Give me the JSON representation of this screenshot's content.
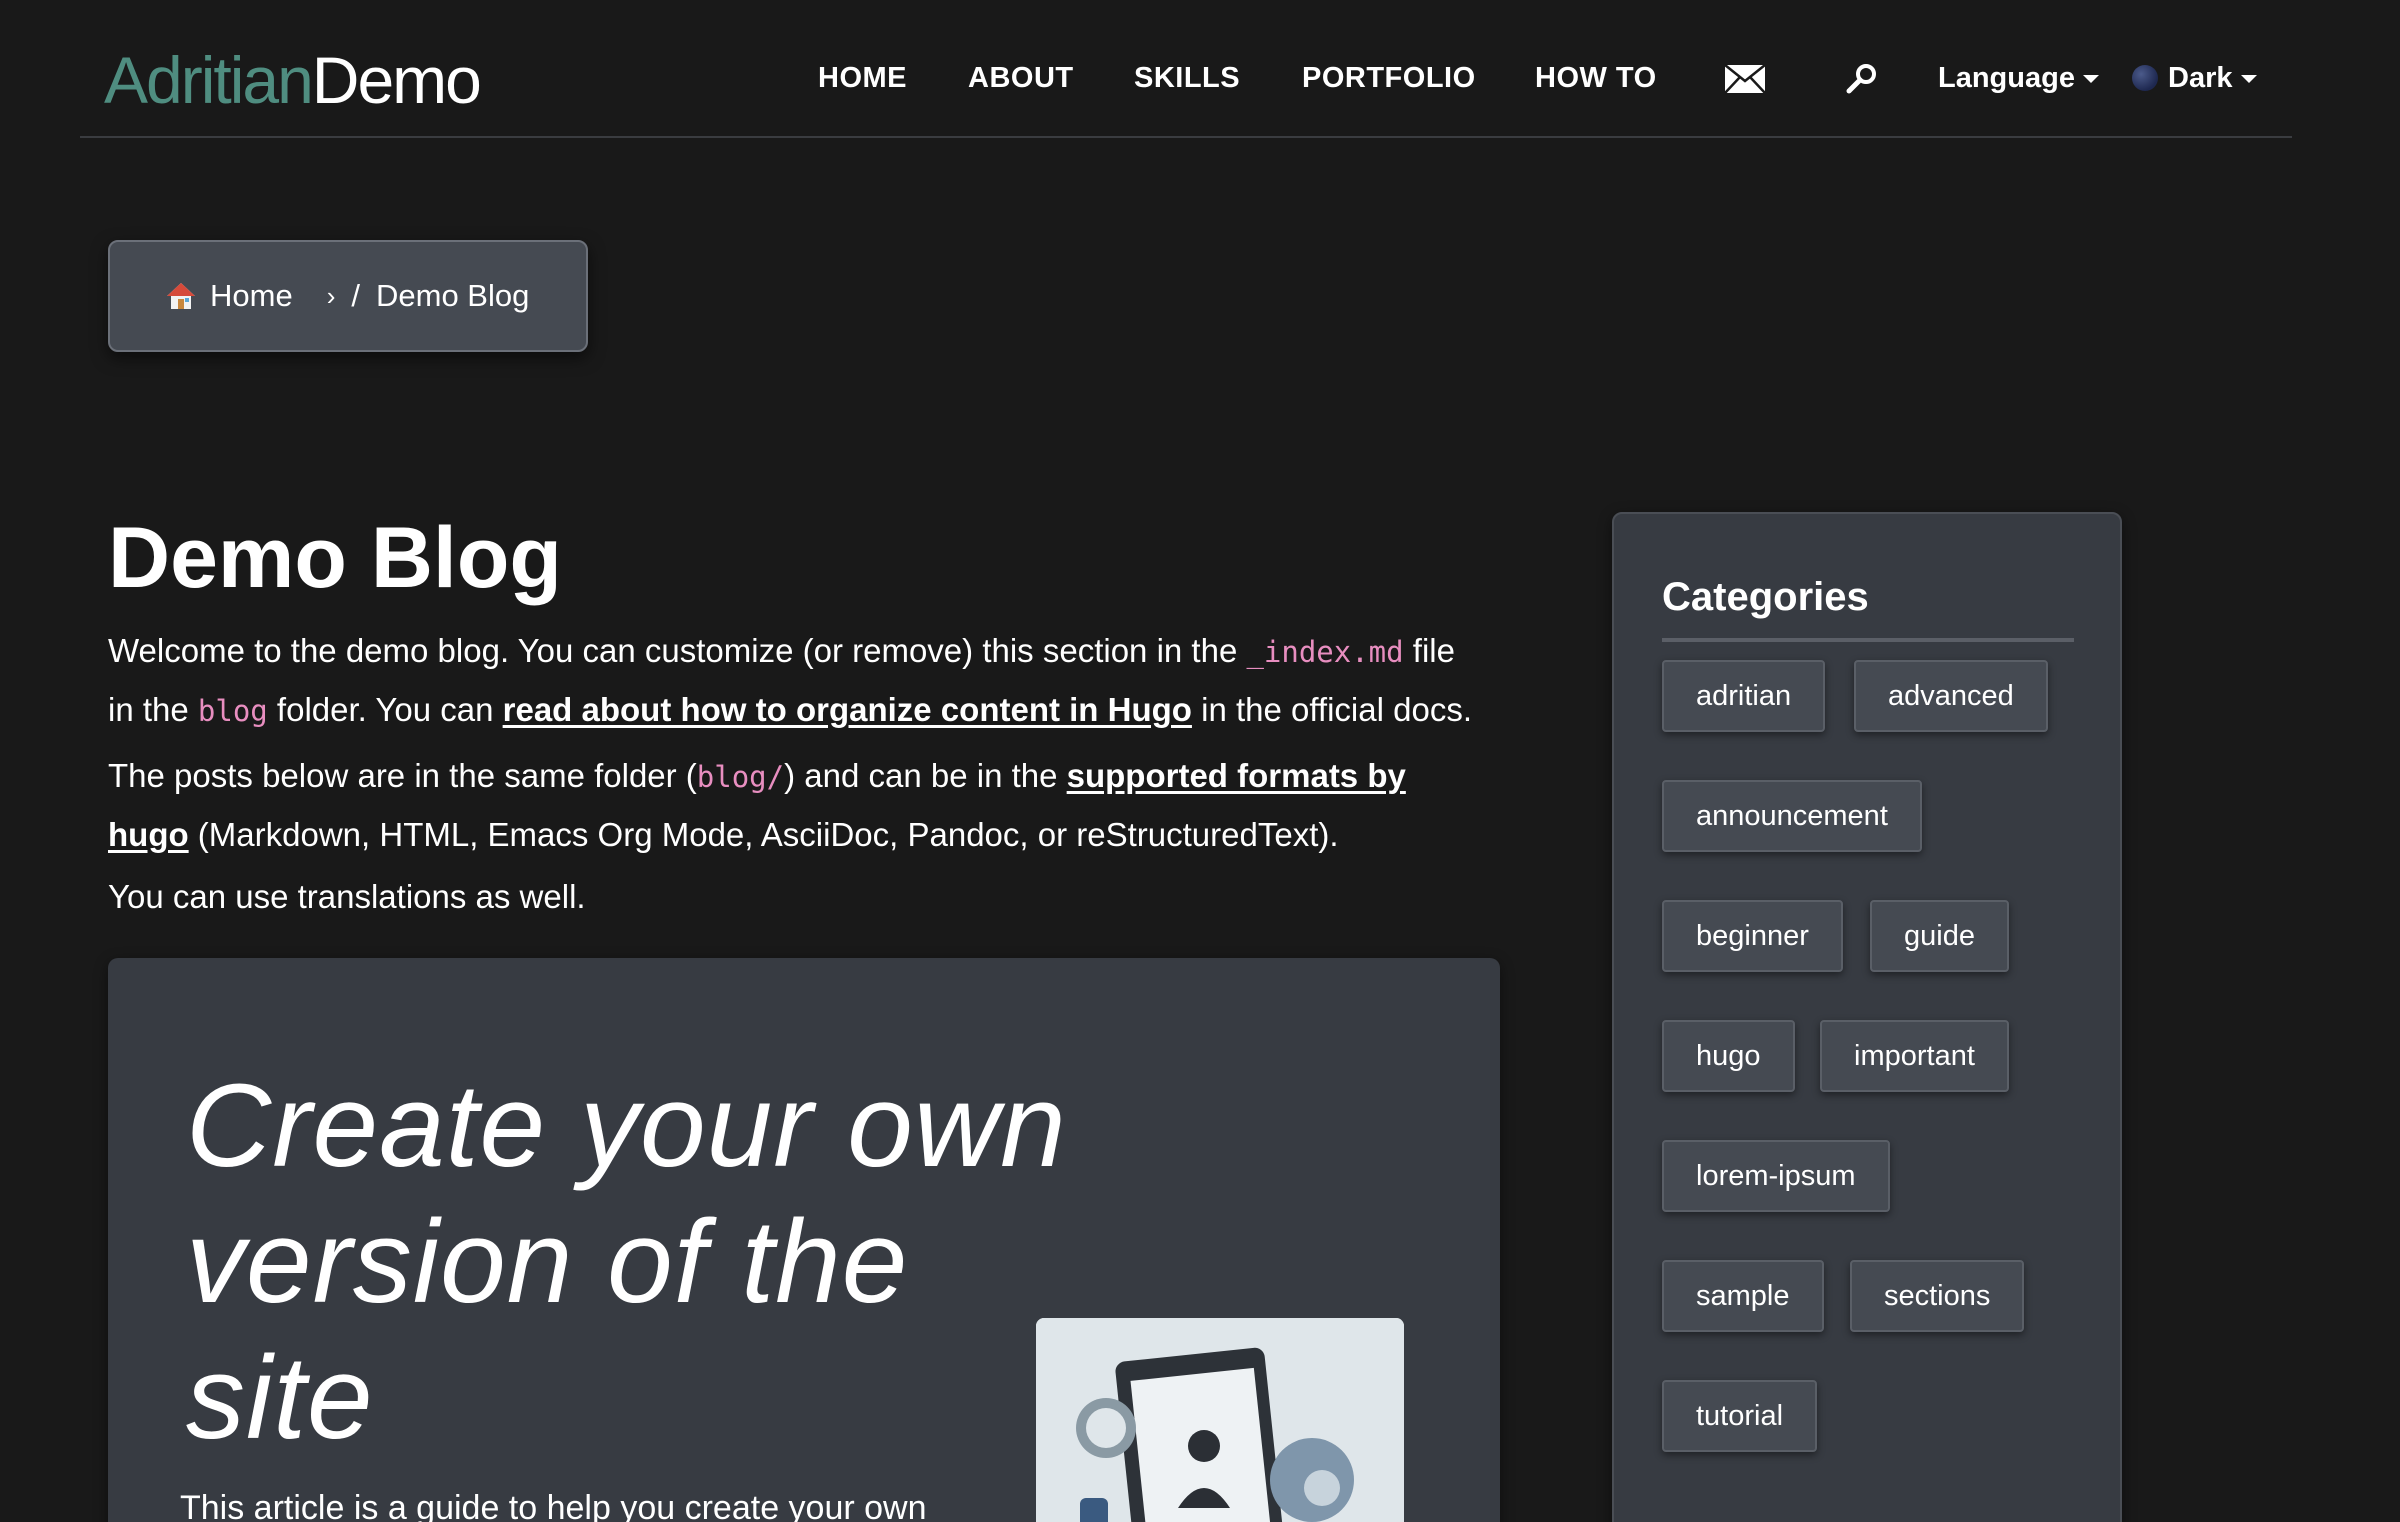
{
  "brand": {
    "part1": "Adritian",
    "part2": "Demo",
    "accent_color": "#4f8d80"
  },
  "nav": {
    "items": [
      {
        "label": "HOME"
      },
      {
        "label": "ABOUT"
      },
      {
        "label": "SKILLS"
      },
      {
        "label": "PORTFOLIO"
      },
      {
        "label": "HOW TO"
      }
    ],
    "mail_icon": "envelope-icon",
    "search_icon": "search-icon",
    "language_label": "Language",
    "theme_label": "Dark"
  },
  "breadcrumb": {
    "home_label": "Home",
    "separator": "›",
    "slash": "/",
    "current": "Demo Blog"
  },
  "main": {
    "title": "Demo Blog",
    "p1": {
      "t1": "Welcome to the demo blog. You can customize (or remove) this section in the ",
      "code1": "_index.md",
      "t2": " file",
      "t3": "in the ",
      "code2": "blog",
      "t4": " folder. You can ",
      "link1": "read about how to organize content in Hugo",
      "t5": " in the official docs."
    },
    "p2": {
      "t1": "The posts below are in the same folder (",
      "code1": "blog/",
      "t2": ") and can be in the ",
      "link1": "supported formats by",
      "link2": "hugo",
      "t3": " (Markdown, HTML, Emacs Org Mode, AsciiDoc, Pandoc, or reStructuredText)."
    },
    "p3": "You can use translations as well.",
    "card": {
      "title": "Create your own version of the site",
      "description": "This article is a guide to help you create your own"
    }
  },
  "sidebar": {
    "title": "Categories",
    "tags": [
      "adritian",
      "advanced",
      "announcement",
      "beginner",
      "guide",
      "hugo",
      "important",
      "lorem-ipsum",
      "sample",
      "sections",
      "tutorial"
    ]
  },
  "colors": {
    "background": "#191919",
    "panel": "#373b42",
    "code": "#e88ec0"
  }
}
